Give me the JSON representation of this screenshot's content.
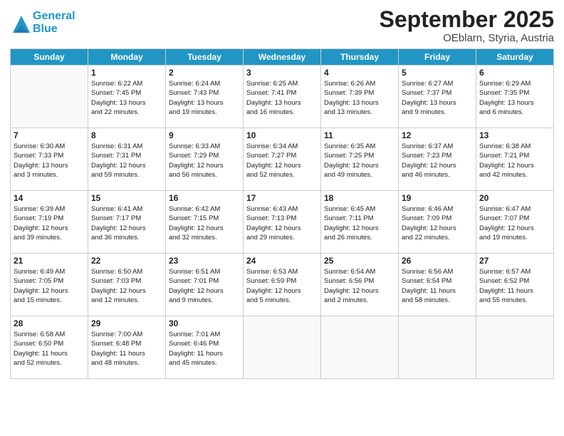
{
  "header": {
    "logo_line1": "General",
    "logo_line2": "Blue",
    "month": "September 2025",
    "location": "OEblarn, Styria, Austria"
  },
  "days_of_week": [
    "Sunday",
    "Monday",
    "Tuesday",
    "Wednesday",
    "Thursday",
    "Friday",
    "Saturday"
  ],
  "weeks": [
    [
      {
        "day": "",
        "info": ""
      },
      {
        "day": "1",
        "info": "Sunrise: 6:22 AM\nSunset: 7:45 PM\nDaylight: 13 hours\nand 22 minutes."
      },
      {
        "day": "2",
        "info": "Sunrise: 6:24 AM\nSunset: 7:43 PM\nDaylight: 13 hours\nand 19 minutes."
      },
      {
        "day": "3",
        "info": "Sunrise: 6:25 AM\nSunset: 7:41 PM\nDaylight: 13 hours\nand 16 minutes."
      },
      {
        "day": "4",
        "info": "Sunrise: 6:26 AM\nSunset: 7:39 PM\nDaylight: 13 hours\nand 13 minutes."
      },
      {
        "day": "5",
        "info": "Sunrise: 6:27 AM\nSunset: 7:37 PM\nDaylight: 13 hours\nand 9 minutes."
      },
      {
        "day": "6",
        "info": "Sunrise: 6:29 AM\nSunset: 7:35 PM\nDaylight: 13 hours\nand 6 minutes."
      }
    ],
    [
      {
        "day": "7",
        "info": "Sunrise: 6:30 AM\nSunset: 7:33 PM\nDaylight: 13 hours\nand 3 minutes."
      },
      {
        "day": "8",
        "info": "Sunrise: 6:31 AM\nSunset: 7:31 PM\nDaylight: 12 hours\nand 59 minutes."
      },
      {
        "day": "9",
        "info": "Sunrise: 6:33 AM\nSunset: 7:29 PM\nDaylight: 12 hours\nand 56 minutes."
      },
      {
        "day": "10",
        "info": "Sunrise: 6:34 AM\nSunset: 7:27 PM\nDaylight: 12 hours\nand 52 minutes."
      },
      {
        "day": "11",
        "info": "Sunrise: 6:35 AM\nSunset: 7:25 PM\nDaylight: 12 hours\nand 49 minutes."
      },
      {
        "day": "12",
        "info": "Sunrise: 6:37 AM\nSunset: 7:23 PM\nDaylight: 12 hours\nand 46 minutes."
      },
      {
        "day": "13",
        "info": "Sunrise: 6:38 AM\nSunset: 7:21 PM\nDaylight: 12 hours\nand 42 minutes."
      }
    ],
    [
      {
        "day": "14",
        "info": "Sunrise: 6:39 AM\nSunset: 7:19 PM\nDaylight: 12 hours\nand 39 minutes."
      },
      {
        "day": "15",
        "info": "Sunrise: 6:41 AM\nSunset: 7:17 PM\nDaylight: 12 hours\nand 36 minutes."
      },
      {
        "day": "16",
        "info": "Sunrise: 6:42 AM\nSunset: 7:15 PM\nDaylight: 12 hours\nand 32 minutes."
      },
      {
        "day": "17",
        "info": "Sunrise: 6:43 AM\nSunset: 7:13 PM\nDaylight: 12 hours\nand 29 minutes."
      },
      {
        "day": "18",
        "info": "Sunrise: 6:45 AM\nSunset: 7:11 PM\nDaylight: 12 hours\nand 26 minutes."
      },
      {
        "day": "19",
        "info": "Sunrise: 6:46 AM\nSunset: 7:09 PM\nDaylight: 12 hours\nand 22 minutes."
      },
      {
        "day": "20",
        "info": "Sunrise: 6:47 AM\nSunset: 7:07 PM\nDaylight: 12 hours\nand 19 minutes."
      }
    ],
    [
      {
        "day": "21",
        "info": "Sunrise: 6:49 AM\nSunset: 7:05 PM\nDaylight: 12 hours\nand 15 minutes."
      },
      {
        "day": "22",
        "info": "Sunrise: 6:50 AM\nSunset: 7:03 PM\nDaylight: 12 hours\nand 12 minutes."
      },
      {
        "day": "23",
        "info": "Sunrise: 6:51 AM\nSunset: 7:01 PM\nDaylight: 12 hours\nand 9 minutes."
      },
      {
        "day": "24",
        "info": "Sunrise: 6:53 AM\nSunset: 6:59 PM\nDaylight: 12 hours\nand 5 minutes."
      },
      {
        "day": "25",
        "info": "Sunrise: 6:54 AM\nSunset: 6:56 PM\nDaylight: 12 hours\nand 2 minutes."
      },
      {
        "day": "26",
        "info": "Sunrise: 6:56 AM\nSunset: 6:54 PM\nDaylight: 11 hours\nand 58 minutes."
      },
      {
        "day": "27",
        "info": "Sunrise: 6:57 AM\nSunset: 6:52 PM\nDaylight: 11 hours\nand 55 minutes."
      }
    ],
    [
      {
        "day": "28",
        "info": "Sunrise: 6:58 AM\nSunset: 6:50 PM\nDaylight: 11 hours\nand 52 minutes."
      },
      {
        "day": "29",
        "info": "Sunrise: 7:00 AM\nSunset: 6:48 PM\nDaylight: 11 hours\nand 48 minutes."
      },
      {
        "day": "30",
        "info": "Sunrise: 7:01 AM\nSunset: 6:46 PM\nDaylight: 11 hours\nand 45 minutes."
      },
      {
        "day": "",
        "info": ""
      },
      {
        "day": "",
        "info": ""
      },
      {
        "day": "",
        "info": ""
      },
      {
        "day": "",
        "info": ""
      }
    ]
  ]
}
